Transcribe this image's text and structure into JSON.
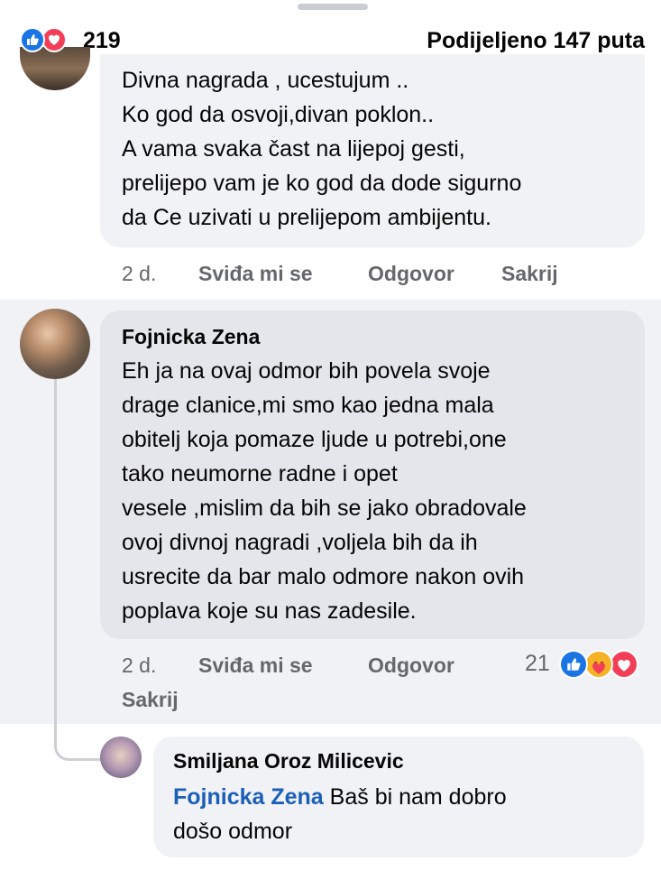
{
  "header": {
    "reaction_icons": [
      "like-icon",
      "love-icon"
    ],
    "reaction_count": "219",
    "shared_text": "Podijeljeno 147 puta"
  },
  "comments": [
    {
      "author": "",
      "lines": [
        "Divna nagrada , ucestujum ..",
        "Ko god da osvoji,divan poklon..",
        "A vama svaka čast na lijepoj gesti,",
        "prelijepo vam je ko god da dode sigurno",
        "da Ce uzivati u prelijepom ambijentu."
      ],
      "age": "2 d.",
      "like_label": "Sviđa mi se",
      "reply_label": "Odgovor",
      "hide_label": "Sakrij"
    },
    {
      "author": "Fojnicka Zena",
      "lines": [
        "Eh ja na ovaj odmor bih povela svoje",
        "drage clanice,mi smo kao jedna mala",
        "obitelj koja pomaze ljude u potrebi,one",
        "tako neumorne radne i opet",
        "vesele ,mislim da bih se jako obradovale",
        "ovoj divnoj nagradi ,voljela bih da ih",
        "usrecite da bar malo odmore nakon ovih",
        "poplava koje su nas zadesile."
      ],
      "age": "2 d.",
      "like_label": "Sviđa mi se",
      "reply_label": "Odgovor",
      "hide_label": "Sakrij",
      "reaction_count": "21",
      "reaction_icons": [
        "like-icon",
        "care-icon",
        "love-icon"
      ]
    }
  ],
  "reply": {
    "author": "Smiljana Oroz Milicevic",
    "mention": "Fojnicka Zena",
    "text_line1": " Baš bi nam dobro",
    "text_line2": "došo odmor"
  },
  "colors": {
    "bubble": "#f0f2f5",
    "like_blue": "#1b74e4",
    "love_red": "#f33e58",
    "mention_blue": "#1b5fb8",
    "secondary_text": "#65676b"
  }
}
